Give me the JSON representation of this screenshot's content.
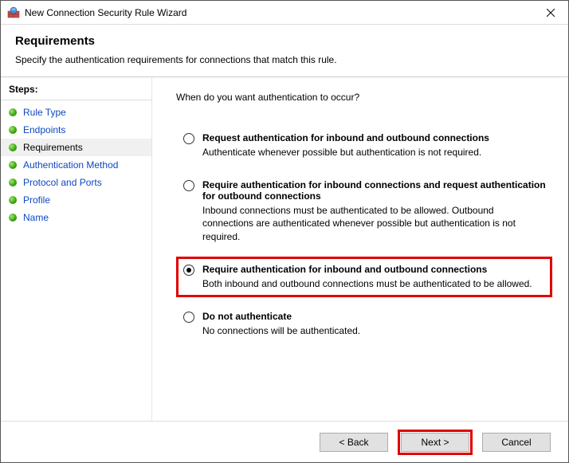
{
  "window": {
    "title": "New Connection Security Rule Wizard"
  },
  "header": {
    "heading": "Requirements",
    "subtitle": "Specify the authentication requirements for connections that match this rule."
  },
  "sidebar": {
    "label": "Steps:",
    "items": [
      {
        "label": "Rule Type",
        "current": false
      },
      {
        "label": "Endpoints",
        "current": false
      },
      {
        "label": "Requirements",
        "current": true
      },
      {
        "label": "Authentication Method",
        "current": false
      },
      {
        "label": "Protocol and Ports",
        "current": false
      },
      {
        "label": "Profile",
        "current": false
      },
      {
        "label": "Name",
        "current": false
      }
    ]
  },
  "main": {
    "question": "When do you want authentication to occur?",
    "options": [
      {
        "title": "Request authentication for inbound and outbound connections",
        "desc": "Authenticate whenever possible but authentication is not required.",
        "selected": false,
        "highlight": false
      },
      {
        "title": "Require authentication for inbound connections and request authentication for outbound connections",
        "desc": "Inbound connections must be authenticated to be allowed. Outbound connections are authenticated whenever possible but authentication is not required.",
        "selected": false,
        "highlight": false
      },
      {
        "title": "Require authentication for inbound and outbound connections",
        "desc": "Both inbound and outbound connections must be authenticated to be allowed.",
        "selected": true,
        "highlight": true
      },
      {
        "title": "Do not authenticate",
        "desc": "No connections will be authenticated.",
        "selected": false,
        "highlight": false
      }
    ]
  },
  "footer": {
    "back": "< Back",
    "next": "Next >",
    "cancel": "Cancel",
    "highlight_next": true
  }
}
